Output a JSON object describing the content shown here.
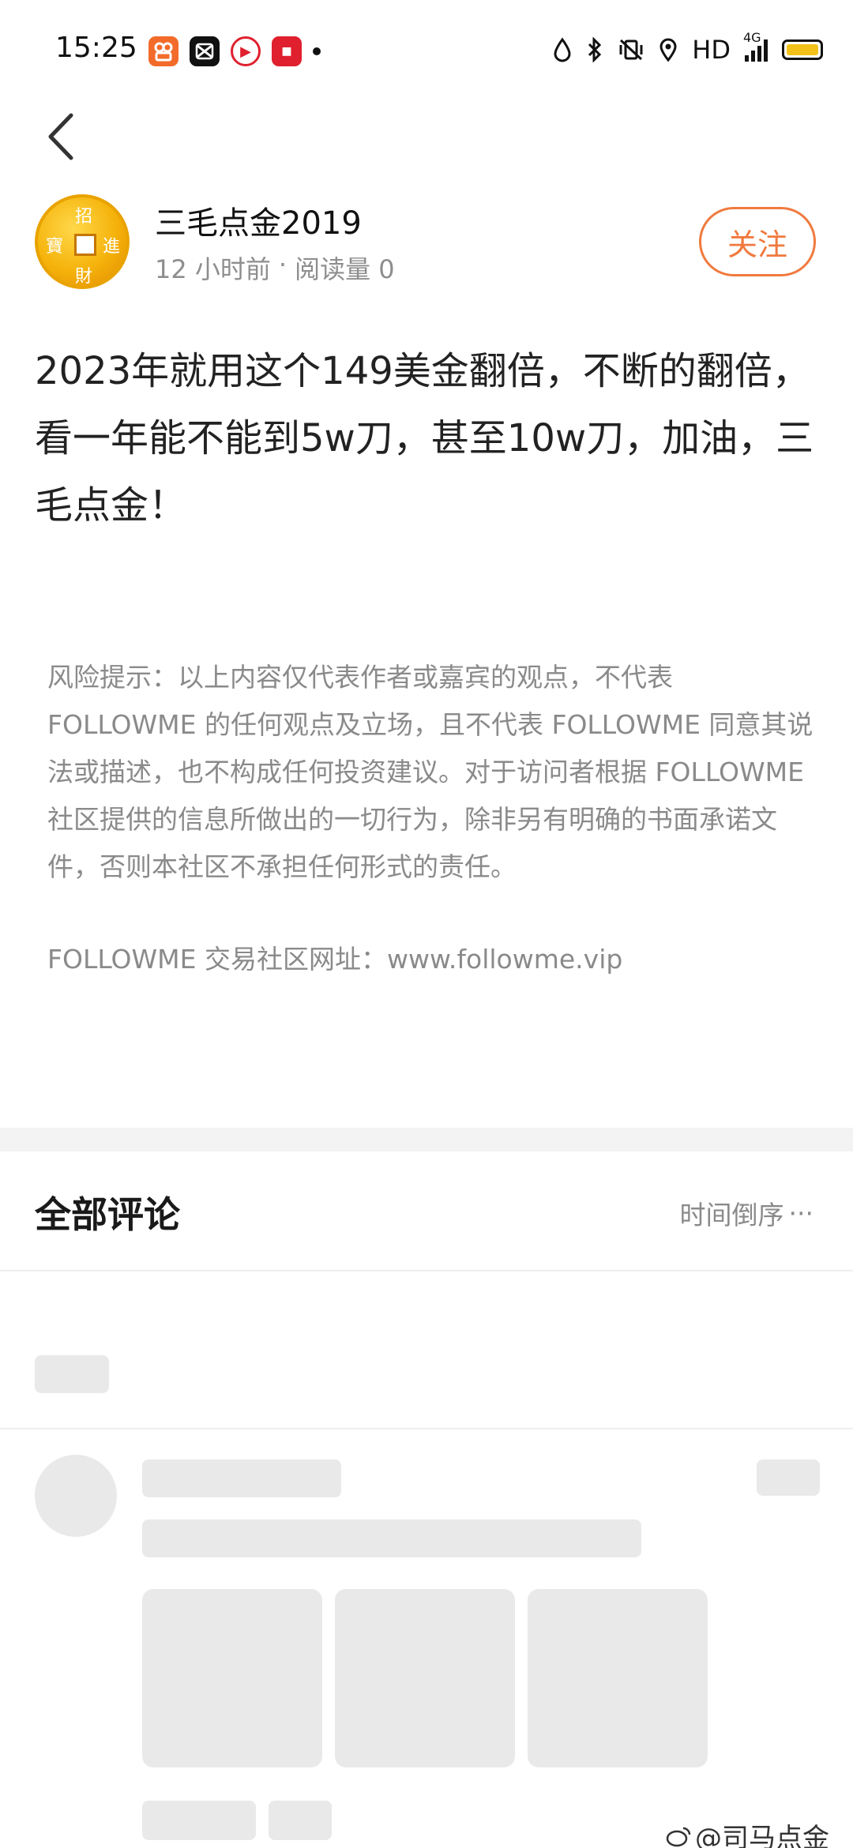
{
  "status_bar": {
    "time": "15:25",
    "app_icons": [
      "kuaishou-icon",
      "capcut-icon",
      "video-app-icon",
      "red-app-icon"
    ],
    "network_label": "HD",
    "network_type": "4G"
  },
  "nav": {
    "back_icon": "back-arrow-icon"
  },
  "author": {
    "name": "三毛点金2019",
    "time_ago": "12 小时前",
    "separator": "·",
    "reads": "阅读量 0",
    "follow_label": "关注",
    "avatar_chars": [
      "招",
      "進",
      "財",
      "寶"
    ]
  },
  "post": {
    "text": "2023年就用这个149美金翻倍，不断的翻倍，看一年能不能到5w刀，甚至10w刀，加油，三毛点金！"
  },
  "disclaimer": {
    "risk_text": "风险提示：以上内容仅代表作者或嘉宾的观点，不代表 FOLLOWME 的任何观点及立场，且不代表 FOLLOWME 同意其说法或描述，也不构成任何投资建议。对于访问者根据 FOLLOWME 社区提供的信息所做出的一切行为，除非另有明确的书面承诺文件，否则本社区不承担任何形式的责任。",
    "site_text": "FOLLOWME 交易社区网址：www.followme.vip"
  },
  "comments": {
    "title": "全部评论",
    "sort_label": "时间倒序",
    "more_icon": "···"
  },
  "watermark": {
    "text": "@司马点金"
  },
  "colors": {
    "accent": "#f07a3e",
    "muted_text": "#8a8a8a",
    "skeleton": "#e9e9e9",
    "coin_gold": "#f5b20a"
  }
}
